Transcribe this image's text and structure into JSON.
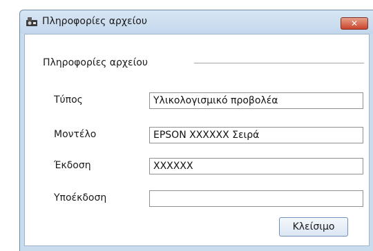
{
  "window": {
    "title": "Πληροφορίες αρχείου",
    "close_glyph": "✕",
    "app_icon": "projector-icon"
  },
  "group": {
    "title": "Πληροφορίες αρχείου"
  },
  "fields": [
    {
      "label": "Τύπος",
      "value": "Υλικολογισμικό προβολέα"
    },
    {
      "label": "Μοντέλο",
      "value": "EPSON XXXXXX  Σειρά"
    },
    {
      "label": "Έκδοση",
      "value": "XXXXXX"
    },
    {
      "label": "Υποέκδοση",
      "value": ""
    }
  ],
  "buttons": {
    "close_label": "Κλείσιμο"
  },
  "colors": {
    "frame": "#c9dcee",
    "close_button": "#c9452b",
    "button_border": "#6d8fb8"
  }
}
